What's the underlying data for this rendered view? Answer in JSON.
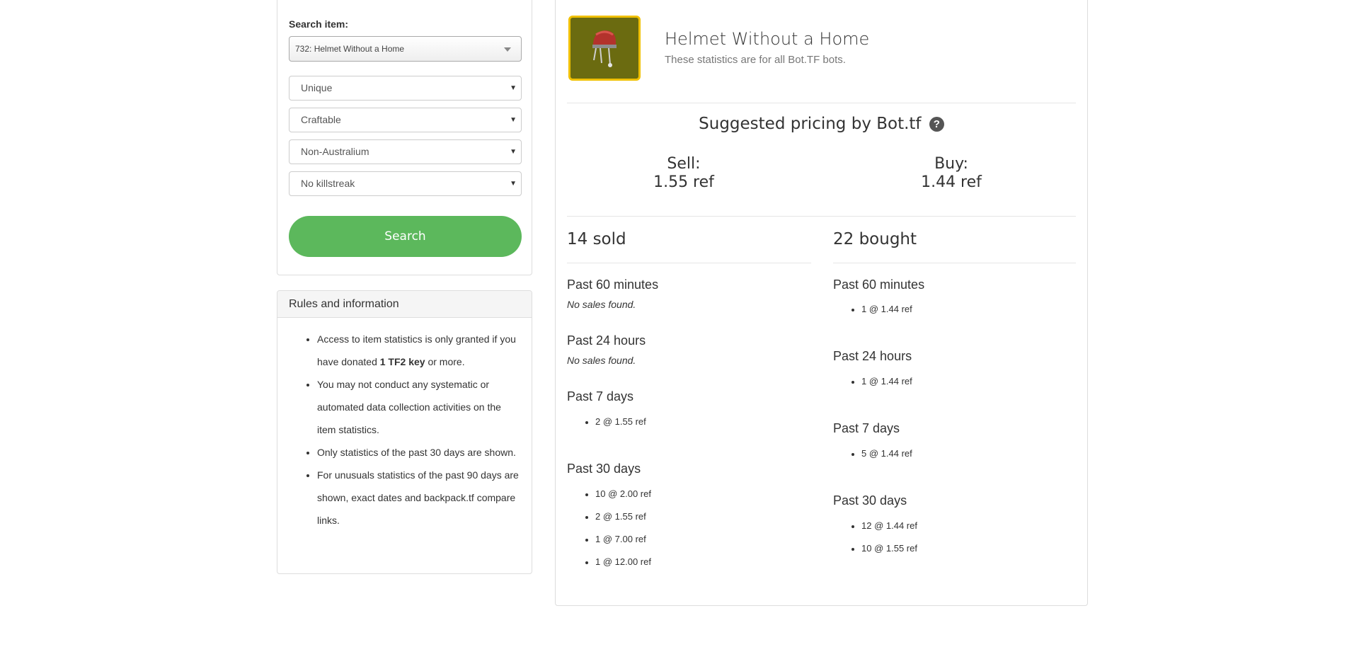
{
  "search": {
    "label": "Search item:",
    "item": "732: Helmet Without a Home",
    "filters": [
      "Unique",
      "Craftable",
      "Non-Australium",
      "No killstreak"
    ],
    "button": "Search"
  },
  "rules": {
    "heading": "Rules and information",
    "items": [
      {
        "before": "Access to item statistics is only granted if you have donated ",
        "bold": "1 TF2 key",
        "after": " or more."
      },
      {
        "text": "You may not conduct any systematic or automated data collection activities on the item statistics."
      },
      {
        "text": "Only statistics of the past 30 days are shown."
      },
      {
        "text": "For unusuals statistics of the past 90 days are shown, exact dates and backpack.tf compare links."
      }
    ]
  },
  "item": {
    "name": "Helmet Without a Home",
    "subtitle": "These statistics are for all Bot.TF bots.",
    "image_bg": "#6b6b10",
    "image_border": "#f0c000"
  },
  "pricing": {
    "title": "Suggested pricing by Bot.tf",
    "help_icon": "question-circle-icon",
    "sell_label": "Sell:",
    "sell_value": "1.55 ref",
    "buy_label": "Buy:",
    "buy_value": "1.44 ref"
  },
  "sold": {
    "count": "14 sold",
    "p60": {
      "label": "Past 60 minutes",
      "empty": "No sales found."
    },
    "p24": {
      "label": "Past 24 hours",
      "empty": "No sales found."
    },
    "p7": {
      "label": "Past 7 days",
      "entries": [
        "2 @ 1.55 ref"
      ]
    },
    "p30": {
      "label": "Past 30 days",
      "entries": [
        "10 @ 2.00 ref",
        "2 @ 1.55 ref",
        "1 @ 7.00 ref",
        "1 @ 12.00 ref"
      ]
    }
  },
  "bought": {
    "count": "22 bought",
    "p60": {
      "label": "Past 60 minutes",
      "entries": [
        "1 @ 1.44 ref"
      ]
    },
    "p24": {
      "label": "Past 24 hours",
      "entries": [
        "1 @ 1.44 ref"
      ]
    },
    "p7": {
      "label": "Past 7 days",
      "entries": [
        "5 @ 1.44 ref"
      ]
    },
    "p30": {
      "label": "Past 30 days",
      "entries": [
        "12 @ 1.44 ref",
        "10 @ 1.55 ref"
      ]
    }
  },
  "colors": {
    "search_button": "#5cb85c",
    "panel_border": "#dddddd"
  }
}
